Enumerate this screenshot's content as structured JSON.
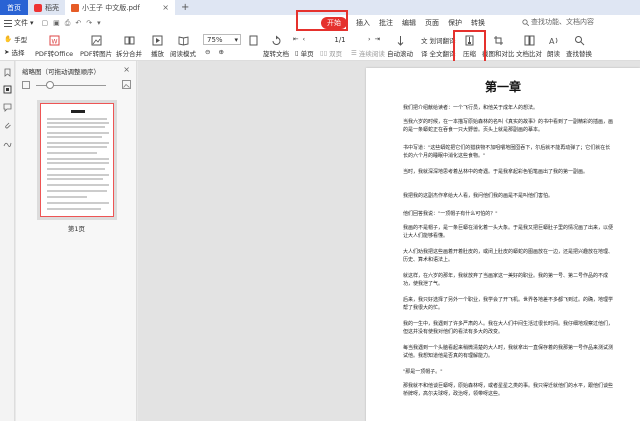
{
  "tabbar": {
    "home": "首页",
    "tab1": "稻壳",
    "tab2": "小王子 中文版.pdf",
    "close": "×",
    "plus": "+"
  },
  "menubar": {
    "file": "文件",
    "file_arrow": "▾",
    "menus": [
      "开始",
      "插入",
      "批注",
      "编辑",
      "页面",
      "保护",
      "转换"
    ],
    "search": "查找功能、文档内容"
  },
  "toolbar": {
    "hand": "手型",
    "select": "选择",
    "pdf_to_office": "PDF转Office",
    "pdf_to_image": "PDF转图片",
    "split_merge": "拆分合并",
    "play": "播放",
    "read_mode": "阅读模式",
    "zoom": "75%",
    "rotate": "旋转文档",
    "single_page": "单页",
    "double_page": "双页",
    "continuous": "连续阅读",
    "page_indicator": "1/1",
    "auto_scroll": "自动滚动",
    "translate": "划词翻译",
    "full_translate": "全文翻译",
    "compress": "压缩",
    "screenshot": "截图和对比",
    "compare": "文档比对",
    "read_aloud": "朗读",
    "find_replace": "查找替换"
  },
  "thumbpanel": {
    "title": "缩略图（可拖动调整顺序）",
    "close": "×",
    "page_label": "第1页"
  },
  "document": {
    "chapter": "第一章",
    "paragraphs": [
      "我们把介绍献给读者：一个飞行员，和他关于成年人的想法。",
      "当我六岁的时候，在一本描写原始森林的名叫《真实的故事》的书中看到了一副精彩的插画，画的是一条蟒蛇正在吞食一只大野兽。页头上就是那副画的摹本。",
      "书中写道：\"这些蟒蛇把它们的猎获物不加咀嚼地囫囵吞下，尔后就不能再动弹了；它们就在长长的六个月的睡眠中消化这些食物。\"",
      "当时，我就深深地思考着丛林中的奇遇。于是我拿起彩色铅笔画出了我的第一副画。",
      "我把我的这副杰作拿给大人看，我问他们我的画是不是叫他们害怕。",
      "他们回答我说：\"一顶帽子有什么可怕的？\"",
      "我画的不是帽子，是一条巨蟒在消化着一头大象。于是我又把巨蟒肚子里的情况画了出来，以便让大人们能够看懂。",
      "大人们劝我把这些画着开着肚皮的，或闭上肚皮的蟒蛇的图画放在一边，还是把兴趣放在地理、历史、算术和语法上。",
      "就这样，在六岁的那年，我就放弃了当画家这一美好的职业。我的第一号、第二号作品的不成功，使我泄了气。",
      "后来，我只好选择了另外一个职业，我学会了开飞机。世界各地差不多都飞到过。的确，地理学帮了我很大的忙。",
      "我的一生中，我遇到了许多严肃的人。我在大人们中间生活过很长时间。我仔细地观察过他们，但这并没有使我对他们的看法有多大的改变。",
      "每当我遇到一个头脑看起来稍微清楚的大人时，我就拿出一直保存着的我那第一号作品来测试测试他。我想知道他是否真的有理解能力。",
      "\"那是一顶帽子。\"",
      "那我就不和他谈巨蟒呀，原始森林呀，或者星星之类的事。我只得迁就他们的水平，跟他们谈些桥牌呀，高尔夫球呀，政治呀，领带呀这些。"
    ]
  }
}
